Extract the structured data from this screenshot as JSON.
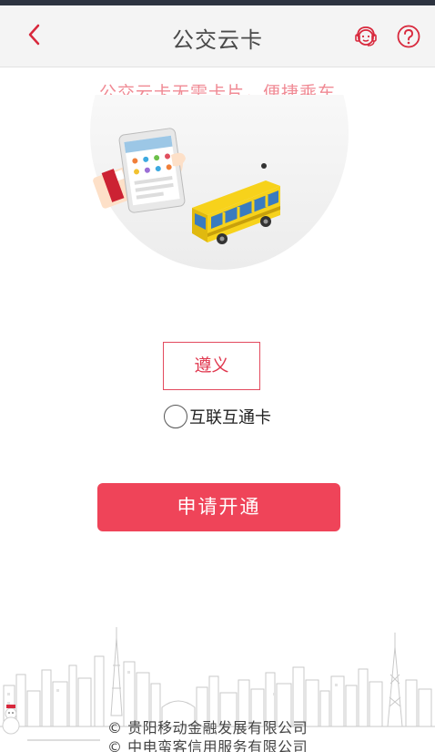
{
  "nav": {
    "back_icon": "chevron-left-icon",
    "title": "公交云卡",
    "service_icon": "customer-service-icon",
    "help_icon": "question-circle-icon"
  },
  "slogan": "公交云卡无需卡片，便捷乘车",
  "city_select": {
    "value": "遵义"
  },
  "card_option": {
    "label": "互联互通卡",
    "checked": false
  },
  "apply_button": {
    "label": "申请开通"
  },
  "footer": {
    "lines": [
      "© 贵阳移动金融发展有限公司",
      "© 中电蛮客信用服务有限公司"
    ]
  },
  "colors": {
    "accent": "#ef4459",
    "nav_icon": "#d8283c",
    "slogan": "#f08a94",
    "bus_body": "#f7d21b",
    "bus_window": "#3a7bbf"
  }
}
